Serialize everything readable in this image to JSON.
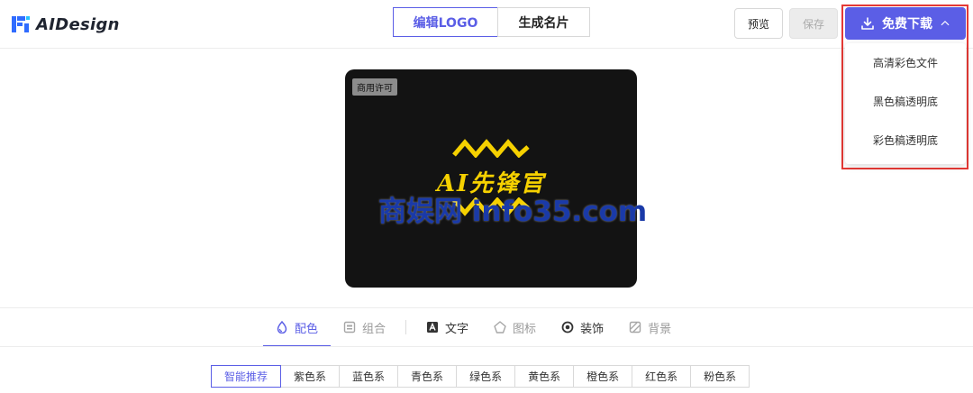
{
  "header": {
    "app_name": "AIDesign",
    "mode_tabs": [
      {
        "label": "编辑LOGO",
        "active": true
      },
      {
        "label": "生成名片",
        "active": false
      }
    ],
    "preview_label": "预览",
    "save_label": "保存",
    "download_label": "免费下载",
    "download_menu": [
      "高清彩色文件",
      "黑色稿透明底",
      "彩色稿透明底"
    ]
  },
  "canvas": {
    "license_badge": "商用许可",
    "brand_text": "AI先锋官",
    "card_background": "#131313",
    "brand_color": "#f6d100"
  },
  "watermark": "商娱网 info35.com",
  "tool_tabs": [
    {
      "label": "配色",
      "icon": "drop-icon",
      "active": true
    },
    {
      "label": "组合",
      "icon": "layout-icon",
      "active": false
    },
    {
      "label": "文字",
      "icon": "text-icon",
      "active": false
    },
    {
      "label": "图标",
      "icon": "shape-icon",
      "active": false
    },
    {
      "label": "装饰",
      "icon": "circle-icon",
      "active": false
    },
    {
      "label": "背景",
      "icon": "background-icon",
      "active": false
    }
  ],
  "color_categories": [
    {
      "label": "智能推荐",
      "active": true
    },
    {
      "label": "紫色系",
      "active": false
    },
    {
      "label": "蓝色系",
      "active": false
    },
    {
      "label": "青色系",
      "active": false
    },
    {
      "label": "绿色系",
      "active": false
    },
    {
      "label": "黄色系",
      "active": false
    },
    {
      "label": "橙色系",
      "active": false
    },
    {
      "label": "红色系",
      "active": false
    },
    {
      "label": "粉色系",
      "active": false
    }
  ],
  "colors": {
    "accent": "#5b5ee6",
    "highlight_border": "#e53935"
  }
}
